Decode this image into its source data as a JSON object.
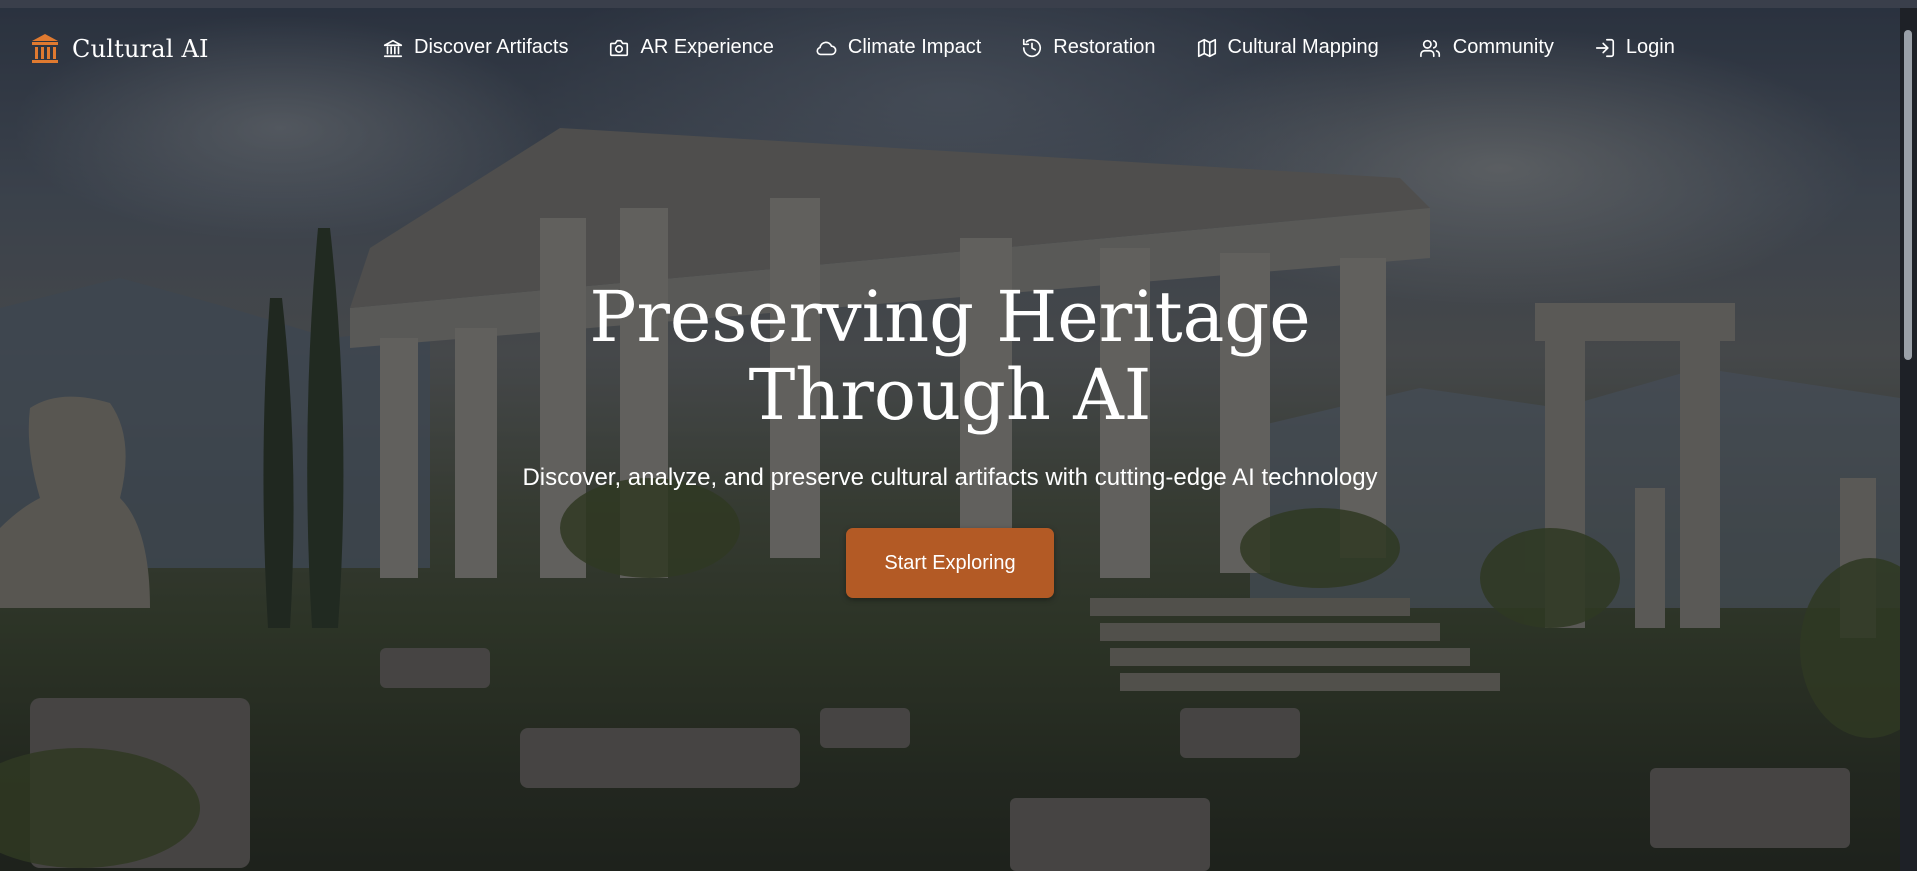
{
  "brand": {
    "name": "Cultural AI",
    "icon": "landmark-icon",
    "accent_color": "#e07a30"
  },
  "nav": {
    "items": [
      {
        "label": "Discover Artifacts",
        "icon": "landmark-icon"
      },
      {
        "label": "AR Experience",
        "icon": "camera-icon"
      },
      {
        "label": "Climate Impact",
        "icon": "cloud-icon"
      },
      {
        "label": "Restoration",
        "icon": "history-icon"
      },
      {
        "label": "Cultural Mapping",
        "icon": "map-icon"
      },
      {
        "label": "Community",
        "icon": "users-icon"
      },
      {
        "label": "Login",
        "icon": "login-icon"
      }
    ]
  },
  "hero": {
    "title": "Preserving Heritage Through AI",
    "subtitle": "Discover, analyze, and preserve cultural artifacts with cutting-edge AI technology",
    "cta_label": "Start Exploring",
    "cta_color": "#b35a25",
    "background": "ancient-temple-ruins-photo"
  }
}
